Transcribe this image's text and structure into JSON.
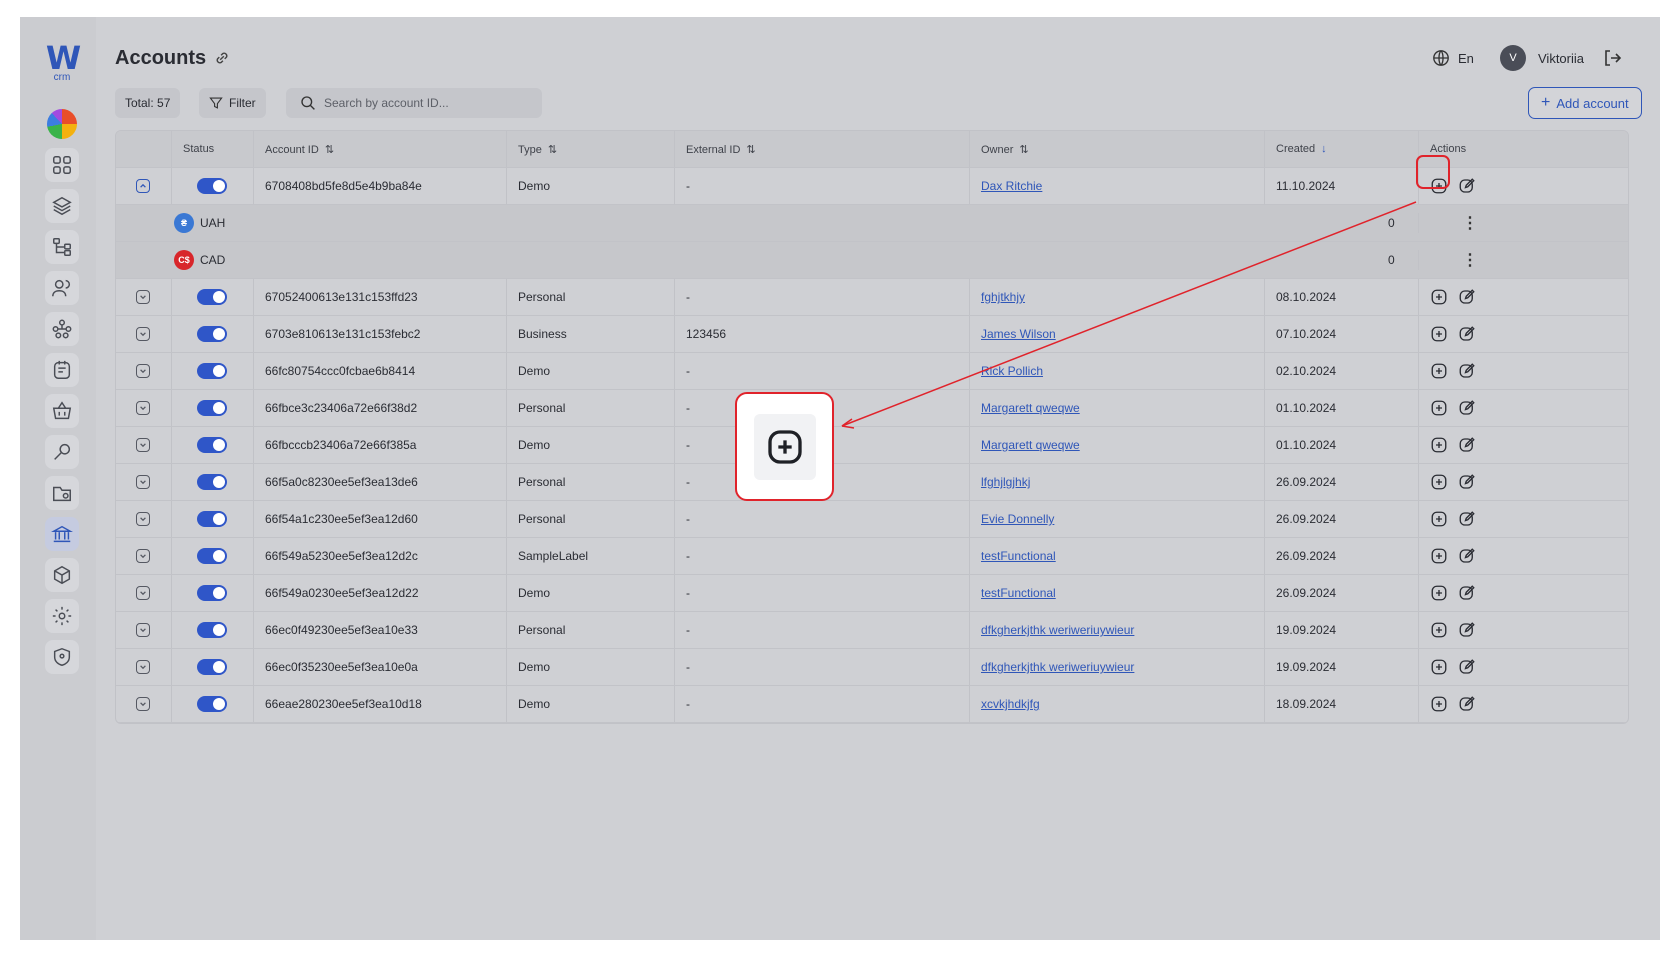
{
  "app": {
    "logo_letter": "W",
    "logo_sub": "crm"
  },
  "sidebar": {
    "items": [
      {
        "name": "dashboard",
        "icon": "grid-icon"
      },
      {
        "name": "layers",
        "icon": "layers-icon"
      },
      {
        "name": "hierarchy",
        "icon": "hierarchy-icon"
      },
      {
        "name": "users",
        "icon": "users-icon"
      },
      {
        "name": "network",
        "icon": "network-icon"
      },
      {
        "name": "tasks",
        "icon": "task-icon"
      },
      {
        "name": "shop",
        "icon": "basket-icon"
      },
      {
        "name": "tools",
        "icon": "tools-icon"
      },
      {
        "name": "folders",
        "icon": "folder-icon"
      },
      {
        "name": "accounts",
        "icon": "bank-icon",
        "active": true
      },
      {
        "name": "box",
        "icon": "cube-icon"
      },
      {
        "name": "settings",
        "icon": "gear-icon"
      },
      {
        "name": "security",
        "icon": "shield-icon"
      }
    ]
  },
  "header": {
    "title": "Accounts",
    "language": "En",
    "user_initial": "V",
    "user_name": "Viktoriia"
  },
  "toolbar": {
    "total_label": "Total: 57",
    "filter_label": "Filter",
    "search_placeholder": "Search by account ID...",
    "add_label": "Add account"
  },
  "table": {
    "columns": [
      "Status",
      "Account ID",
      "Type",
      "External ID",
      "Owner",
      "Created",
      "Actions"
    ],
    "rows": [
      {
        "id": "6708408bd5fe8d5e4b9ba84e",
        "type": "Demo",
        "external": "-",
        "owner": "Dax Ritchie",
        "created": "11.10.2024",
        "expanded": true
      },
      {
        "id": "67052400613e131c153ffd23",
        "type": "Personal",
        "external": "-",
        "owner": "fghjtkhjy",
        "created": "08.10.2024"
      },
      {
        "id": "6703e810613e131c153febc2",
        "type": "Business",
        "external": "123456",
        "owner": "James Wilson",
        "created": "07.10.2024"
      },
      {
        "id": "66fc80754ccc0fcbae6b8414",
        "type": "Demo",
        "external": "-",
        "owner": "Rick Pollich",
        "created": "02.10.2024"
      },
      {
        "id": "66fbce3c23406a72e66f38d2",
        "type": "Personal",
        "external": "-",
        "owner": "Margarett qweqwe",
        "created": "01.10.2024"
      },
      {
        "id": "66fbcccb23406a72e66f385a",
        "type": "Demo",
        "external": "-",
        "owner": "Margarett qweqwe",
        "created": "01.10.2024"
      },
      {
        "id": "66f5a0c8230ee5ef3ea13de6",
        "type": "Personal",
        "external": "-",
        "owner": "lfghjlgjhkj",
        "created": "26.09.2024"
      },
      {
        "id": "66f54a1c230ee5ef3ea12d60",
        "type": "Personal",
        "external": "-",
        "owner": "Evie Donnelly",
        "created": "26.09.2024"
      },
      {
        "id": "66f549a5230ee5ef3ea12d2c",
        "type": "SampleLabel",
        "external": "-",
        "owner": "testFunctional",
        "created": "26.09.2024"
      },
      {
        "id": "66f549a0230ee5ef3ea12d22",
        "type": "Demo",
        "external": "-",
        "owner": "testFunctional",
        "created": "26.09.2024"
      },
      {
        "id": "66ec0f49230ee5ef3ea10e33",
        "type": "Personal",
        "external": "-",
        "owner": "dfkgherkjthk weriweriuywieur",
        "created": "19.09.2024"
      },
      {
        "id": "66ec0f35230ee5ef3ea10e0a",
        "type": "Demo",
        "external": "-",
        "owner": "dfkgherkjthk weriweriuywieur",
        "created": "19.09.2024"
      },
      {
        "id": "66eae280230ee5ef3ea10d18",
        "type": "Demo",
        "external": "-",
        "owner": "xcvkjhdkjfg",
        "created": "18.09.2024"
      }
    ],
    "sub_rows": [
      {
        "currency": "UAH",
        "symbol": "₴",
        "color": "#3a78d4",
        "balance": "0"
      },
      {
        "currency": "CAD",
        "symbol": "C$",
        "color": "#d8262b",
        "balance": "0"
      }
    ]
  },
  "annotation": {
    "highlight_color": "#e0232b",
    "target": "add-balance-icon"
  }
}
